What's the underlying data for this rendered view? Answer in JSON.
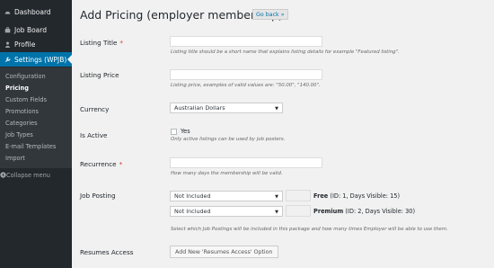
{
  "sidebar": {
    "items": [
      {
        "label": "Dashboard",
        "icon": "dashboard-icon"
      },
      {
        "label": "Job Board",
        "icon": "briefcase-icon"
      },
      {
        "label": "Profile",
        "icon": "user-icon"
      },
      {
        "label": "Settings (WPJB)",
        "icon": "wrench-icon"
      }
    ],
    "submenu": [
      "Configuration",
      "Pricing",
      "Custom Fields",
      "Promotions",
      "Categories",
      "Job Types",
      "E-mail Templates",
      "Import"
    ],
    "current_submenu": "Pricing",
    "collapse_label": "Collapse menu"
  },
  "page": {
    "title": "Add Pricing (employer membership)",
    "go_back": "Go back »"
  },
  "form": {
    "listing_title": {
      "label": "Listing Title",
      "required": "*",
      "value": "",
      "hint": "Listing title should be a short name that explains listing details for example \"Featured listing\"."
    },
    "listing_price": {
      "label": "Listing Price",
      "value": "",
      "hint": "Listing price, examples of valid values are: \"50.00\", \"140.00\"."
    },
    "currency": {
      "label": "Currency",
      "value": "Australian Dollars"
    },
    "is_active": {
      "label": "Is Active",
      "checkbox_label": "Yes",
      "checked": false,
      "hint": "Only active listings can be used by job posters."
    },
    "recurrence": {
      "label": "Recurrence",
      "required": "*",
      "value": "",
      "hint": "How many days the membership will be valid."
    },
    "job_posting": {
      "label": "Job Posting",
      "rows": [
        {
          "select": "Not Included",
          "count": "",
          "name": "Free",
          "detail": " (ID: 1, Days Visible: 15)"
        },
        {
          "select": "Not Included",
          "count": "",
          "name": "Premium",
          "detail": " (ID: 2, Days Visible: 30)"
        }
      ],
      "hint": "Select which Job Postings will be included in this package and how many times Employer will be able to use them."
    },
    "resumes_access": {
      "label": "Resumes Access",
      "button": "Add New 'Resumes Access' Option"
    }
  },
  "colors": {
    "sidebar_bg": "#23282d",
    "submenu_bg": "#32373c",
    "accent": "#0073aa",
    "required": "#dc3232"
  }
}
